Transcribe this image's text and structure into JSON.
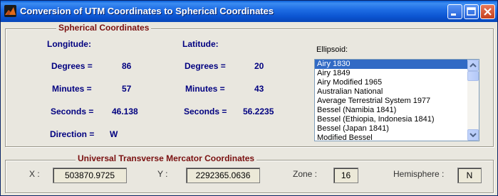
{
  "window": {
    "title": "Conversion of UTM Coordinates to Spherical Coordinates"
  },
  "spherical": {
    "legend": "Spherical Coordinates",
    "longitude": {
      "header": "Longitude:",
      "degrees_label": "Degrees =",
      "degrees": "86",
      "minutes_label": "Minutes =",
      "minutes": "57",
      "seconds_label": "Seconds =",
      "seconds": "46.138",
      "direction_label": "Direction =",
      "direction": "W"
    },
    "latitude": {
      "header": "Latitude:",
      "degrees_label": "Degrees =",
      "degrees": "20",
      "minutes_label": "Minutes =",
      "minutes": "43",
      "seconds_label": "Seconds =",
      "seconds": "56.2235"
    },
    "ellipsoid": {
      "label": "Ellipsoid:",
      "selected": "Airy 1830",
      "options": [
        "Airy 1830",
        "Airy 1849",
        "Airy Modified 1965",
        "Australian National",
        "Average Terrestrial System 1977",
        "Bessel (Namibia 1841)",
        "Bessel (Ethiopia, Indonesia 1841)",
        "Bessel (Japan 1841)",
        "Modified Bessel"
      ]
    }
  },
  "utm": {
    "legend": "Universal Transverse Mercator Coordinates",
    "x_label": "X :",
    "x": "503870.9725",
    "y_label": "Y :",
    "y": "2292365.0636",
    "zone_label": "Zone :",
    "zone": "16",
    "hemisphere_label": "Hemisphere :",
    "hemisphere": "N"
  },
  "colors": {
    "titlebar": "#0b54d1",
    "accent_text": "#000080",
    "legend_text": "#7a1010",
    "selection": "#316ac5"
  }
}
